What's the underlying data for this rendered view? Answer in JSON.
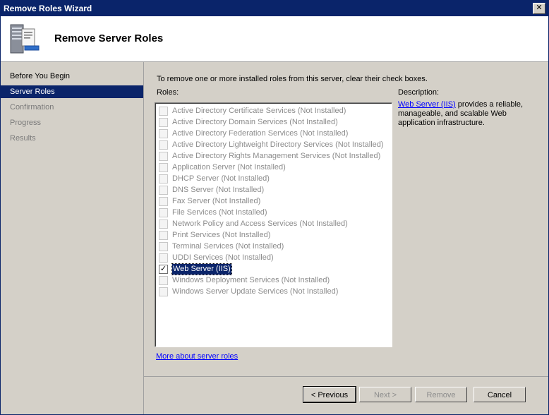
{
  "window": {
    "title": "Remove Roles Wizard",
    "close_glyph": "✕"
  },
  "header": {
    "title": "Remove Server Roles",
    "icon": "server-icon"
  },
  "sidebar": {
    "items": [
      {
        "label": "Before You Begin",
        "state": "normal"
      },
      {
        "label": "Server Roles",
        "state": "active"
      },
      {
        "label": "Confirmation",
        "state": "disabled"
      },
      {
        "label": "Progress",
        "state": "disabled"
      },
      {
        "label": "Results",
        "state": "disabled"
      }
    ]
  },
  "main": {
    "instruction": "To remove one or more installed roles from this server, clear their check boxes.",
    "roles_label": "Roles:",
    "roles": [
      {
        "label": "Active Directory Certificate Services  (Not Installed)",
        "checked": false,
        "enabled": false
      },
      {
        "label": "Active Directory Domain Services  (Not Installed)",
        "checked": false,
        "enabled": false
      },
      {
        "label": "Active Directory Federation Services  (Not Installed)",
        "checked": false,
        "enabled": false
      },
      {
        "label": "Active Directory Lightweight Directory Services  (Not Installed)",
        "checked": false,
        "enabled": false
      },
      {
        "label": "Active Directory Rights Management Services  (Not Installed)",
        "checked": false,
        "enabled": false
      },
      {
        "label": "Application Server  (Not Installed)",
        "checked": false,
        "enabled": false
      },
      {
        "label": "DHCP Server  (Not Installed)",
        "checked": false,
        "enabled": false
      },
      {
        "label": "DNS Server  (Not Installed)",
        "checked": false,
        "enabled": false
      },
      {
        "label": "Fax Server  (Not Installed)",
        "checked": false,
        "enabled": false
      },
      {
        "label": "File Services  (Not Installed)",
        "checked": false,
        "enabled": false
      },
      {
        "label": "Network Policy and Access Services  (Not Installed)",
        "checked": false,
        "enabled": false
      },
      {
        "label": "Print Services  (Not Installed)",
        "checked": false,
        "enabled": false
      },
      {
        "label": "Terminal Services  (Not Installed)",
        "checked": false,
        "enabled": false
      },
      {
        "label": "UDDI Services  (Not Installed)",
        "checked": false,
        "enabled": false
      },
      {
        "label": "Web Server (IIS)",
        "checked": true,
        "enabled": true
      },
      {
        "label": "Windows Deployment Services  (Not Installed)",
        "checked": false,
        "enabled": false
      },
      {
        "label": "Windows Server Update Services  (Not Installed)",
        "checked": false,
        "enabled": false
      }
    ],
    "description_label": "Description:",
    "description_link": "Web Server (IIS)",
    "description_text": " provides a reliable, manageable, and scalable Web application infrastructure.",
    "more_link": "More about server roles"
  },
  "footer": {
    "previous": "< Previous",
    "next": "Next >",
    "remove": "Remove",
    "cancel": "Cancel"
  },
  "colors": {
    "selection": "#0a246a",
    "disabled_text": "#8c8c8c",
    "link": "#0000ff"
  }
}
